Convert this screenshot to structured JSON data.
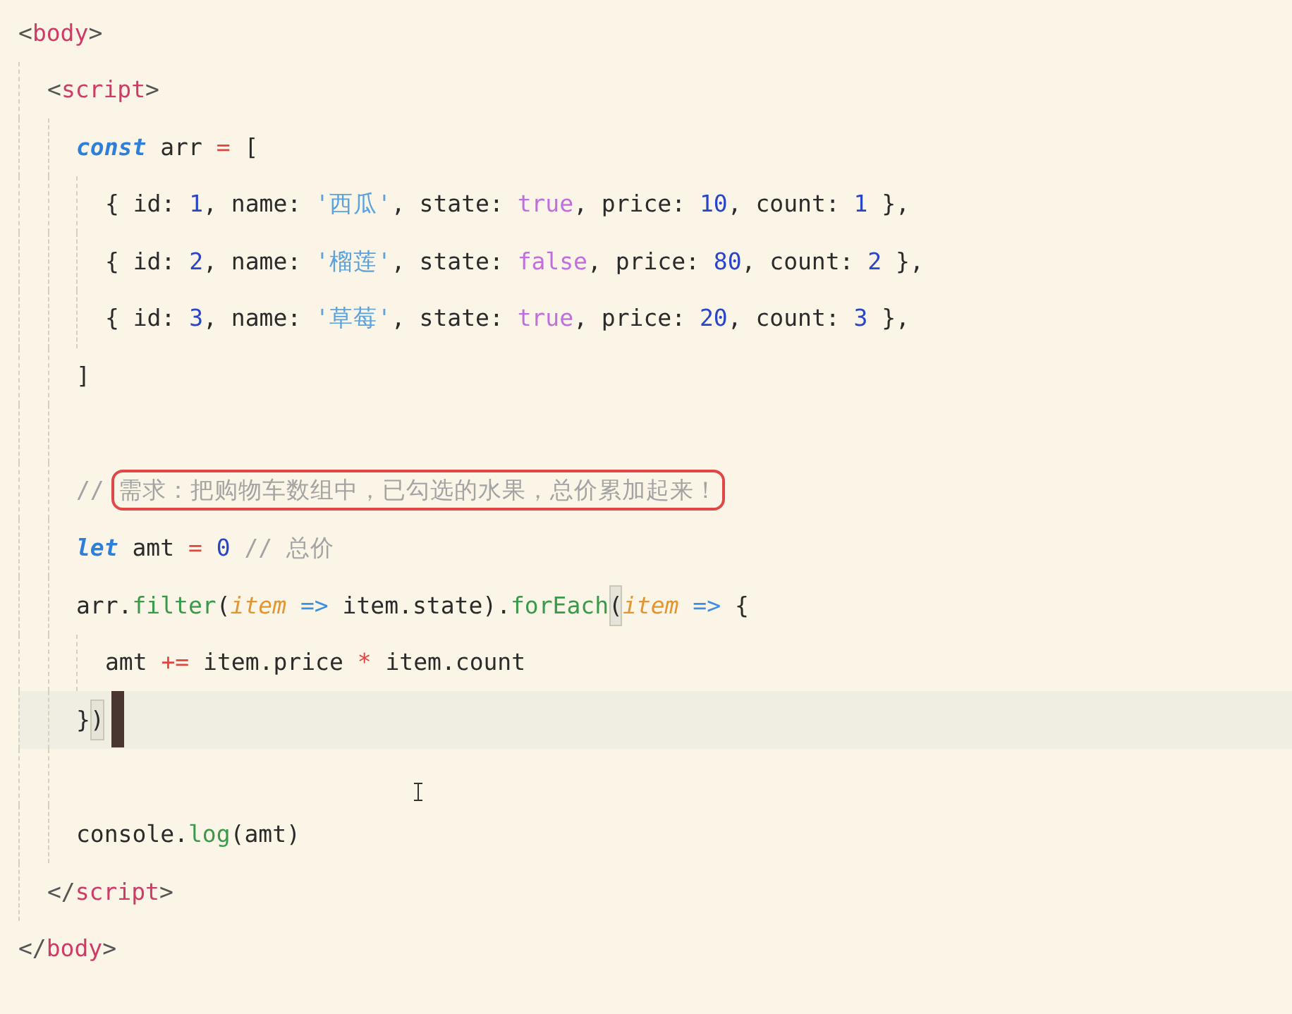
{
  "editor": {
    "lines": [
      {
        "kind": "code",
        "tokens": [
          {
            "kind": "punct",
            "text": "<"
          },
          {
            "kind": "tag",
            "text": "body"
          },
          {
            "kind": "punct",
            "text": ">"
          }
        ],
        "children": [
          {
            "kind": "code",
            "tokens": [
              {
                "kind": "punct",
                "text": "<"
              },
              {
                "kind": "tag",
                "text": "script"
              },
              {
                "kind": "punct",
                "text": ">"
              }
            ],
            "children": [
              {
                "kind": "code",
                "tokens": [
                  {
                    "kind": "keyword",
                    "text": "const"
                  },
                  {
                    "kind": "plain",
                    "text": " arr "
                  },
                  {
                    "kind": "operator",
                    "text": "="
                  },
                  {
                    "kind": "plain",
                    "text": " ["
                  }
                ],
                "children": [
                  {
                    "kind": "code",
                    "tokens": [
                      {
                        "kind": "plain",
                        "text": "{ id: "
                      },
                      {
                        "kind": "number",
                        "text": "1"
                      },
                      {
                        "kind": "plain",
                        "text": ", name: "
                      },
                      {
                        "kind": "string",
                        "text": "'西瓜'"
                      },
                      {
                        "kind": "plain",
                        "text": ", state: "
                      },
                      {
                        "kind": "boolean",
                        "text": "true"
                      },
                      {
                        "kind": "plain",
                        "text": ", price: "
                      },
                      {
                        "kind": "number",
                        "text": "10"
                      },
                      {
                        "kind": "plain",
                        "text": ", count: "
                      },
                      {
                        "kind": "number",
                        "text": "1"
                      },
                      {
                        "kind": "plain",
                        "text": " },"
                      }
                    ]
                  },
                  {
                    "kind": "code",
                    "tokens": [
                      {
                        "kind": "plain",
                        "text": "{ id: "
                      },
                      {
                        "kind": "number",
                        "text": "2"
                      },
                      {
                        "kind": "plain",
                        "text": ", name: "
                      },
                      {
                        "kind": "string",
                        "text": "'榴莲'"
                      },
                      {
                        "kind": "plain",
                        "text": ", state: "
                      },
                      {
                        "kind": "boolean",
                        "text": "false"
                      },
                      {
                        "kind": "plain",
                        "text": ", price: "
                      },
                      {
                        "kind": "number",
                        "text": "80"
                      },
                      {
                        "kind": "plain",
                        "text": ", count: "
                      },
                      {
                        "kind": "number",
                        "text": "2"
                      },
                      {
                        "kind": "plain",
                        "text": " },"
                      }
                    ]
                  },
                  {
                    "kind": "code",
                    "tokens": [
                      {
                        "kind": "plain",
                        "text": "{ id: "
                      },
                      {
                        "kind": "number",
                        "text": "3"
                      },
                      {
                        "kind": "plain",
                        "text": ", name: "
                      },
                      {
                        "kind": "string",
                        "text": "'草莓'"
                      },
                      {
                        "kind": "plain",
                        "text": ", state: "
                      },
                      {
                        "kind": "boolean",
                        "text": "true"
                      },
                      {
                        "kind": "plain",
                        "text": ", price: "
                      },
                      {
                        "kind": "number",
                        "text": "20"
                      },
                      {
                        "kind": "plain",
                        "text": ", count: "
                      },
                      {
                        "kind": "number",
                        "text": "3"
                      },
                      {
                        "kind": "plain",
                        "text": " },"
                      }
                    ]
                  }
                ]
              },
              {
                "kind": "code",
                "tokens": [
                  {
                    "kind": "plain",
                    "text": "]"
                  }
                ]
              },
              {
                "kind": "blank"
              },
              {
                "kind": "code",
                "tokens": [
                  {
                    "kind": "comment",
                    "text": "// "
                  },
                  {
                    "kind": "boxed-comment",
                    "text": "需求：把购物车数组中，已勾选的水果，总价累加起来！"
                  }
                ]
              },
              {
                "kind": "code",
                "tokens": [
                  {
                    "kind": "keyword",
                    "text": "let"
                  },
                  {
                    "kind": "plain",
                    "text": " amt "
                  },
                  {
                    "kind": "operator",
                    "text": "="
                  },
                  {
                    "kind": "number",
                    "text": " 0"
                  },
                  {
                    "kind": "comment",
                    "text": " // 总价"
                  }
                ]
              },
              {
                "kind": "code",
                "tokens": [
                  {
                    "kind": "plain",
                    "text": "arr."
                  },
                  {
                    "kind": "function",
                    "text": "filter"
                  },
                  {
                    "kind": "plain",
                    "text": "("
                  },
                  {
                    "kind": "param",
                    "text": "item"
                  },
                  {
                    "kind": "arrow",
                    "text": " =>"
                  },
                  {
                    "kind": "plain",
                    "text": " item.state)."
                  },
                  {
                    "kind": "function",
                    "text": "forEach"
                  },
                  {
                    "kind": "bracket-match",
                    "text": "("
                  },
                  {
                    "kind": "param",
                    "text": "item"
                  },
                  {
                    "kind": "arrow",
                    "text": " =>"
                  },
                  {
                    "kind": "plain",
                    "text": " {"
                  }
                ],
                "children": [
                  {
                    "kind": "code",
                    "tokens": [
                      {
                        "kind": "plain",
                        "text": "amt "
                      },
                      {
                        "kind": "operator",
                        "text": "+="
                      },
                      {
                        "kind": "plain",
                        "text": " item.price "
                      },
                      {
                        "kind": "operator",
                        "text": "*"
                      },
                      {
                        "kind": "plain",
                        "text": " item.count"
                      }
                    ]
                  }
                ]
              },
              {
                "kind": "cursor-line",
                "tokens": [
                  {
                    "kind": "plain",
                    "text": "}"
                  },
                  {
                    "kind": "bracket-match",
                    "text": ")"
                  }
                ]
              },
              {
                "kind": "blank"
              },
              {
                "kind": "code",
                "tokens": [
                  {
                    "kind": "plain",
                    "text": "console."
                  },
                  {
                    "kind": "function",
                    "text": "log"
                  },
                  {
                    "kind": "plain",
                    "text": "(amt)"
                  }
                ]
              }
            ]
          },
          {
            "kind": "code",
            "tokens": [
              {
                "kind": "punct",
                "text": "</"
              },
              {
                "kind": "tag",
                "text": "script"
              },
              {
                "kind": "punct",
                "text": ">"
              }
            ]
          }
        ]
      },
      {
        "kind": "code",
        "tokens": [
          {
            "kind": "punct",
            "text": "</"
          },
          {
            "kind": "tag",
            "text": "body"
          },
          {
            "kind": "punct",
            "text": ">"
          }
        ]
      }
    ]
  }
}
